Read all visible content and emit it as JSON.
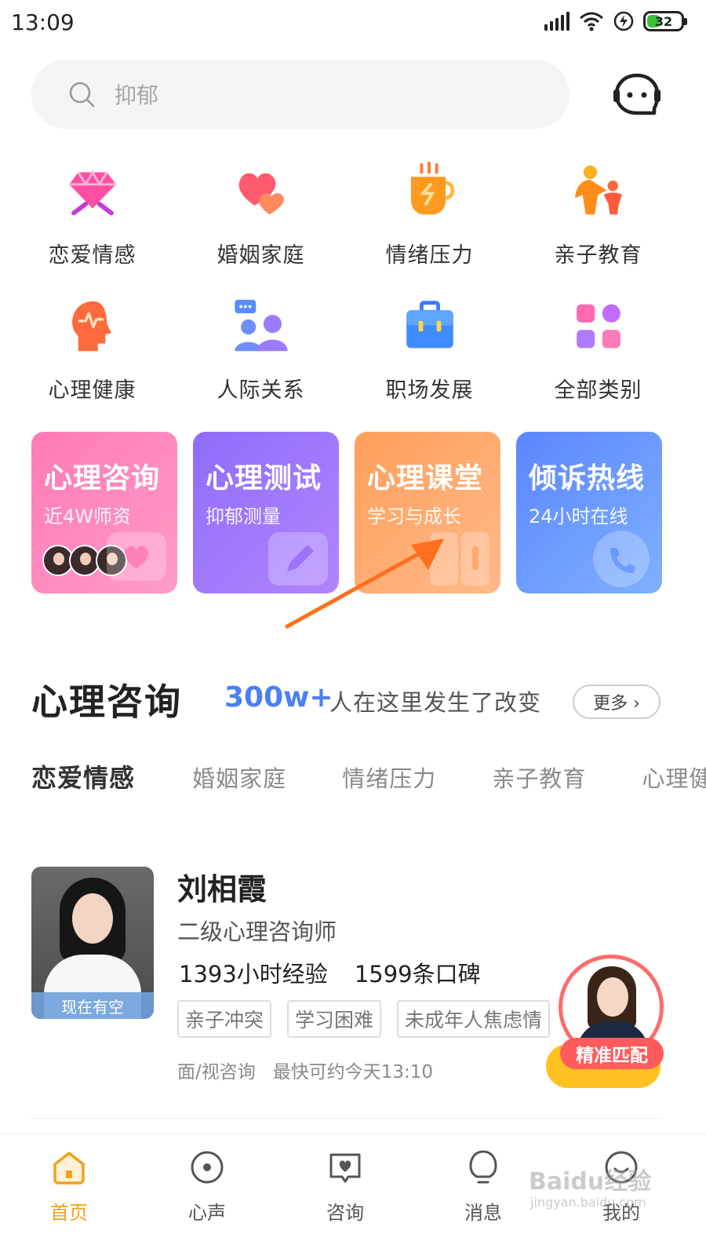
{
  "status": {
    "time": "13:09",
    "battery": "32"
  },
  "search": {
    "placeholder": "抑郁"
  },
  "categories": [
    {
      "label": "恋爱情感",
      "icon": "diamond-icon"
    },
    {
      "label": "婚姻家庭",
      "icon": "hearts-icon"
    },
    {
      "label": "情绪压力",
      "icon": "cup-icon"
    },
    {
      "label": "亲子教育",
      "icon": "parent-child-icon"
    },
    {
      "label": "心理健康",
      "icon": "brain-head-icon"
    },
    {
      "label": "人际关系",
      "icon": "people-chat-icon"
    },
    {
      "label": "职场发展",
      "icon": "briefcase-icon"
    },
    {
      "label": "全部类别",
      "icon": "grid-icon"
    }
  ],
  "services": [
    {
      "title": "心理咨询",
      "sub": "近4W师资"
    },
    {
      "title": "心理测试",
      "sub": "抑郁测量"
    },
    {
      "title": "心理课堂",
      "sub": "学习与成长"
    },
    {
      "title": "倾诉热线",
      "sub": "24小时在线"
    }
  ],
  "section": {
    "title": "心理咨询",
    "count": "300w+",
    "desc": "人在这里发生了改变",
    "more": "更多 ›"
  },
  "tabs": [
    "恋爱情感",
    "婚姻家庭",
    "情绪压力",
    "亲子教育",
    "心理健康"
  ],
  "counselor": {
    "name": "刘相霞",
    "title": "二级心理咨询师",
    "hours": "1393小时经验",
    "reviews": "1599条口碑",
    "status": "现在有空",
    "tags": [
      "亲子冲突",
      "学习困难",
      "未成年人焦虑情"
    ],
    "mode": "面/视咨询",
    "earliest": "最快可约今天13:10",
    "match_label": "精准匹配"
  },
  "nav": [
    {
      "label": "首页",
      "icon": "home-icon"
    },
    {
      "label": "心声",
      "icon": "voice-icon"
    },
    {
      "label": "咨询",
      "icon": "consult-icon"
    },
    {
      "label": "消息",
      "icon": "bell-icon"
    },
    {
      "label": "我的",
      "icon": "profile-icon"
    }
  ],
  "colors": {
    "accent": "#f4a11a",
    "link_blue": "#4a7ff5",
    "consult_btn": "#ffc021"
  },
  "watermark": {
    "text": "Baidu经验",
    "sub": "jingyan.baidu.com"
  }
}
